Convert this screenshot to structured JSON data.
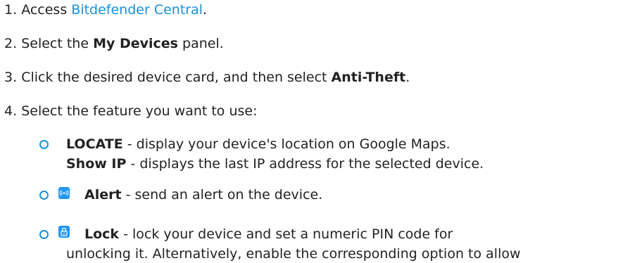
{
  "steps": [
    {
      "num": "1.",
      "pre": "Access ",
      "link": "Bitdefender Central",
      "post": "."
    },
    {
      "num": "2.",
      "pre": "Select the ",
      "bold": "My Devices",
      "post": " panel."
    },
    {
      "num": "3.",
      "pre": "Click the desired device card, and then select ",
      "bold": "Anti-Theft",
      "post": "."
    },
    {
      "num": "4.",
      "text": "Select the feature you want to use:"
    }
  ],
  "features": {
    "locate": {
      "bold": "LOCATE",
      "text": " - display your device's location on Google Maps.",
      "sub_bold": "Show IP",
      "sub_text": " - displays the last IP address for the selected device."
    },
    "alert": {
      "icon": "alert-signal-icon",
      "bold": "Alert",
      "text": " - send an alert on the device."
    },
    "lock": {
      "icon": "padlock-icon",
      "bold": "Lock",
      "text": " - lock your device and set a numeric PIN code for",
      "line2": "unlocking it. Alternatively, enable the corresponding option to allow"
    }
  },
  "colors": {
    "link": "#1a8fd6",
    "bullet": "#1a8fd6",
    "icon_bg": "#2196f3"
  }
}
